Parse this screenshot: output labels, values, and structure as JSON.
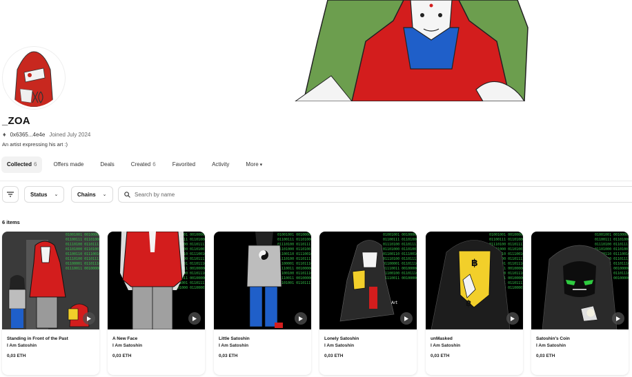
{
  "profile": {
    "name": "_ZOA",
    "address": "0x6365...4e4e",
    "joined": "Joined July 2024",
    "bio": "An artist expressing his art :)"
  },
  "tabs": [
    {
      "label": "Collected",
      "count": "6"
    },
    {
      "label": "Offers made",
      "count": ""
    },
    {
      "label": "Deals",
      "count": ""
    },
    {
      "label": "Created",
      "count": "6"
    },
    {
      "label": "Favorited",
      "count": ""
    },
    {
      "label": "Activity",
      "count": ""
    },
    {
      "label": "More",
      "count": ""
    }
  ],
  "filters": {
    "status_label": "Status",
    "chains_label": "Chains",
    "search_placeholder": "Search by name"
  },
  "items_count": "6 items",
  "items": [
    {
      "title": "Standing in Front of the Past",
      "collection": "I Am Satoshin",
      "price": "0,03 ETH"
    },
    {
      "title": "A New Face",
      "collection": "I Am Satoshin",
      "price": "0,03 ETH"
    },
    {
      "title": "Little Satoshin",
      "collection": "I Am Satoshin",
      "price": "0,03 ETH"
    },
    {
      "title": "Lonely Satoshin",
      "collection": "I Am Satoshin",
      "price": "0,03 ETH"
    },
    {
      "title": "unMasked",
      "collection": "I Am Satoshin",
      "price": "0,03 ETH"
    },
    {
      "title": "Satoshin's Coin",
      "collection": "I Am Satoshin",
      "price": "0,03 ETH"
    }
  ],
  "icons": {
    "eth": "ethereum-icon",
    "filter": "filter-icon",
    "search": "search-icon",
    "play": "play-icon",
    "chevron": "chevron-down-icon"
  },
  "colors": {
    "hoodie_red": "#d31d1d",
    "chair_green": "#6c9e4e",
    "code_green": "#35c24a",
    "coin_yellow": "#f2cf2a"
  }
}
